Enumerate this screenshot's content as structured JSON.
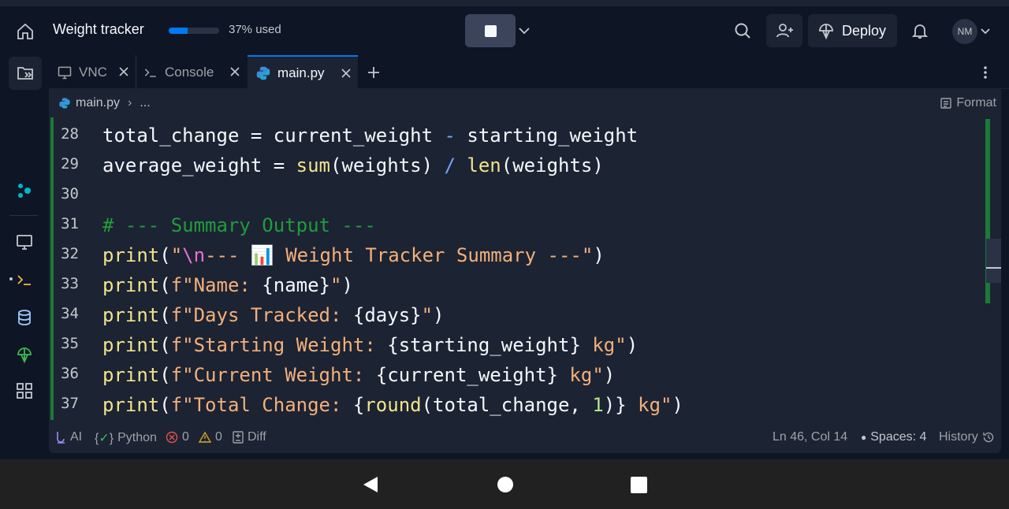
{
  "header": {
    "title": "Weight tracker",
    "usage_label": "37% used",
    "usage_fraction": 0.37,
    "deploy_label": "Deploy",
    "avatar_initials": "NM"
  },
  "tabs": [
    {
      "label": "VNC",
      "icon": "monitor-icon",
      "active": false
    },
    {
      "label": "Console",
      "icon": "terminal-icon",
      "active": false
    },
    {
      "label": "main.py",
      "icon": "python-icon",
      "active": true
    }
  ],
  "breadcrumb": {
    "file": "main.py",
    "rest": "..."
  },
  "format_label": "Format",
  "code": {
    "lines": [
      {
        "n": "28"
      },
      {
        "n": "29"
      },
      {
        "n": "30"
      },
      {
        "n": "31"
      },
      {
        "n": "32"
      },
      {
        "n": "33"
      },
      {
        "n": "34"
      },
      {
        "n": "35"
      },
      {
        "n": "36"
      },
      {
        "n": "37"
      }
    ],
    "l28": [
      "total_change",
      " = ",
      "current_weight",
      " - ",
      "starting_weight"
    ],
    "l29": [
      "average_weight = ",
      "sum",
      "(weights) ",
      "/",
      " ",
      "len",
      "(weights)"
    ],
    "l31": "# --- Summary Output ---",
    "l32": [
      "print",
      "(",
      "\"",
      "\\n",
      "--- 📊 Weight Tracker Summary ---\"",
      ")"
    ],
    "l33": [
      "print",
      "(",
      "f\"Name: ",
      "{name}",
      "\"",
      ")"
    ],
    "l34": [
      "print",
      "(",
      "f\"Days Tracked: ",
      "{days}",
      "\"",
      ")"
    ],
    "l35": [
      "print",
      "(",
      "f\"Starting Weight: ",
      "{starting_weight}",
      " kg\"",
      ")"
    ],
    "l36": [
      "print",
      "(",
      "f\"Current Weight: ",
      "{current_weight}",
      " kg\"",
      ")"
    ],
    "l37": [
      "print",
      "(",
      "f\"Total Change: ",
      "{",
      "round",
      "(total_change, ",
      "1",
      ")}",
      " kg\"",
      ")"
    ]
  },
  "status": {
    "ai": "AI",
    "language": "Python",
    "errors": "0",
    "warnings": "0",
    "diff": "Diff",
    "position": "Ln 46, Col 14",
    "spaces": "Spaces: 4",
    "history": "History"
  },
  "colors": {
    "accent": "#0079f2",
    "bg": "#0e1525",
    "panel": "#1c2333"
  }
}
